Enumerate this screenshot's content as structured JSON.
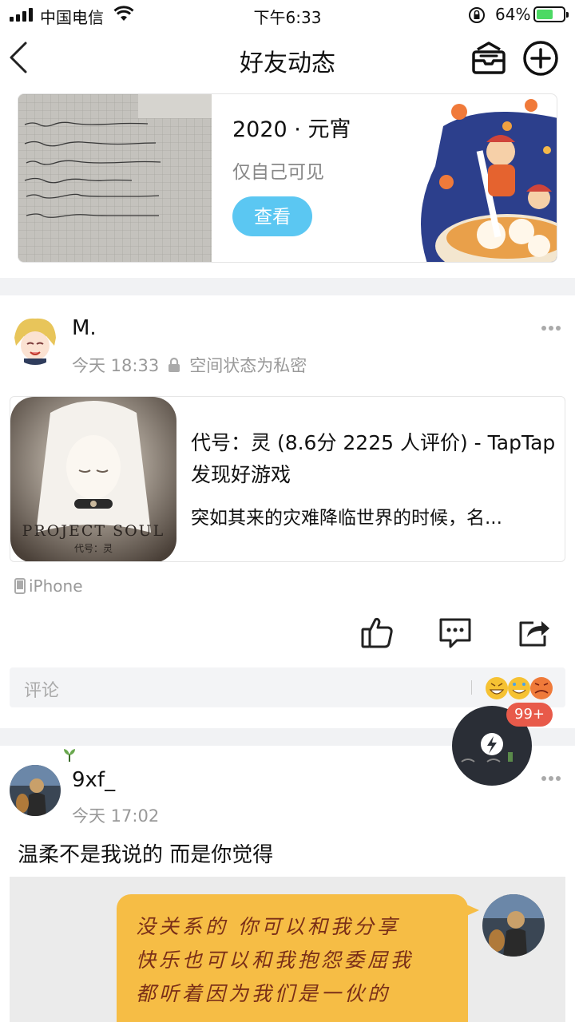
{
  "status": {
    "carrier": "中国电信",
    "time": "下午6:33",
    "battery_pct": "64%",
    "battery_level": 0.64
  },
  "nav": {
    "title": "好友动态"
  },
  "memory": {
    "title": "2020 · 元宵",
    "visibility": "仅自己可见",
    "view_label": "查看"
  },
  "post1": {
    "username": "M.",
    "time": "今天 18:33",
    "privacy": "空间状态为私密",
    "link_title": "代号：灵 (8.6分 2225 人评价) - TapTap 发现好游戏",
    "link_desc": "突如其来的灾难降临世界的时候，名...",
    "thumb_caption_1": "PROJECT SOUL",
    "thumb_caption_2": "代号：灵",
    "device": "iPhone",
    "comment_placeholder": "评论"
  },
  "float": {
    "badge": "99+"
  },
  "post2": {
    "username": "9xf_",
    "time": "今天 17:02",
    "text": "温柔不是我说的  而是你觉得",
    "bubble_lines": [
      "没关系的 你可以和我分享",
      "快乐也可以和我抱怨委屈我",
      "都听着因为我们是一伙的"
    ]
  },
  "colors": {
    "accent_blue": "#5bc7f2",
    "badge_red": "#e85a4a",
    "bubble_yellow": "#f6bd45"
  }
}
